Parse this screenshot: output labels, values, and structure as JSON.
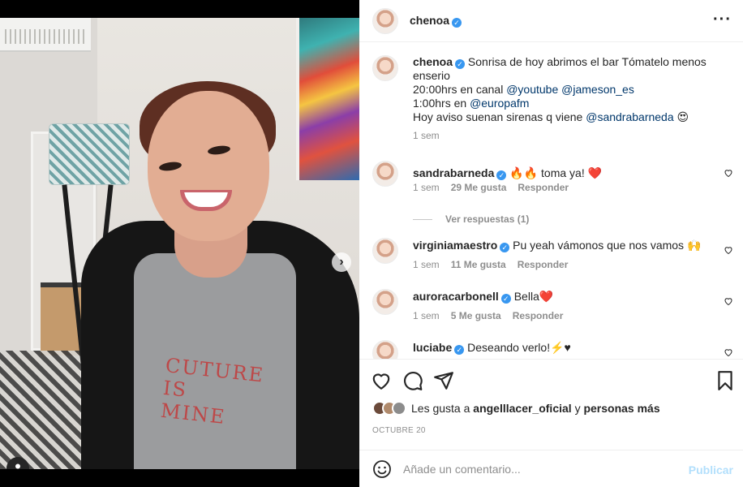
{
  "post": {
    "author": "chenoa",
    "more_icon": "more-horizontal-icon",
    "caption": {
      "username": "chenoa",
      "line1": " Sonrisa de hoy abrimos el bar Tómatelo menos enserio",
      "line2_prefix": "20:00hrs en canal ",
      "line2_m1": "@youtube",
      "line2_m2": "@jameson_es",
      "line3_prefix": "1:00hrs en ",
      "line3_m1": "@europafm",
      "line4_prefix": "Hoy aviso suenan sirenas q viene ",
      "line4_m1": "@sandrabarneda",
      "line4_emoji": "😍",
      "time": "1 sem"
    }
  },
  "comments": [
    {
      "user": "sandrabarneda",
      "text": "🔥🔥 toma ya! ❤️",
      "time": "1 sem",
      "likes": "29 Me gusta",
      "reply": "Responder"
    },
    {
      "user": "virginiamaestro",
      "text": "Pu yeah vámonos que nos vamos 🙌",
      "time": "1 sem",
      "likes": "11 Me gusta",
      "reply": "Responder"
    },
    {
      "user": "auroracarbonell",
      "text": "Bella❤️",
      "time": "1 sem",
      "likes": "5 Me gusta",
      "reply": "Responder"
    },
    {
      "user": "luciabe",
      "text": "Deseando verlo!⚡️♥"
    }
  ],
  "view_replies": "Ver respuestas (1)",
  "likes": {
    "prefix": "Les gusta a ",
    "user": "angelllacer_oficial",
    "middle": " y ",
    "suffix": "personas más"
  },
  "date": "OCTUBRE 20",
  "add_comment": {
    "placeholder": "Añade un comentario...",
    "publish": "Publicar"
  },
  "photo": {
    "shirt_text": "CUTURE IS MINE"
  },
  "colors": {
    "accent": "#3897f0",
    "mention": "#00376b",
    "muted": "#8e8e8e",
    "publish_disabled": "#b2dffc",
    "like_red": "#ed4956"
  }
}
